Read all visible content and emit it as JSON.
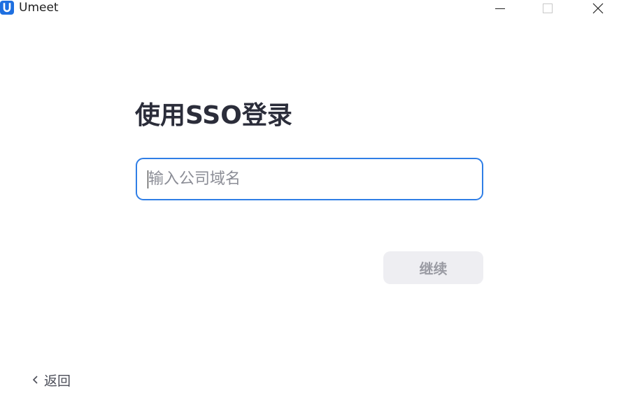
{
  "window": {
    "title": "Umeet",
    "controls": {
      "minimize": "minimize-icon",
      "maximize": "maximize-icon",
      "close": "close-icon"
    }
  },
  "main": {
    "title": "使用SSO登录",
    "domain_input": {
      "value": "",
      "placeholder": "输入公司域名"
    },
    "continue_label": "继续",
    "back_label": "返回"
  },
  "colors": {
    "accent": "#2f7ee6",
    "logo": "#1e6fe0",
    "disabled_button_bg": "#eeeef2",
    "disabled_button_text": "#9a9ba3",
    "title_text": "#2b2d3a"
  }
}
